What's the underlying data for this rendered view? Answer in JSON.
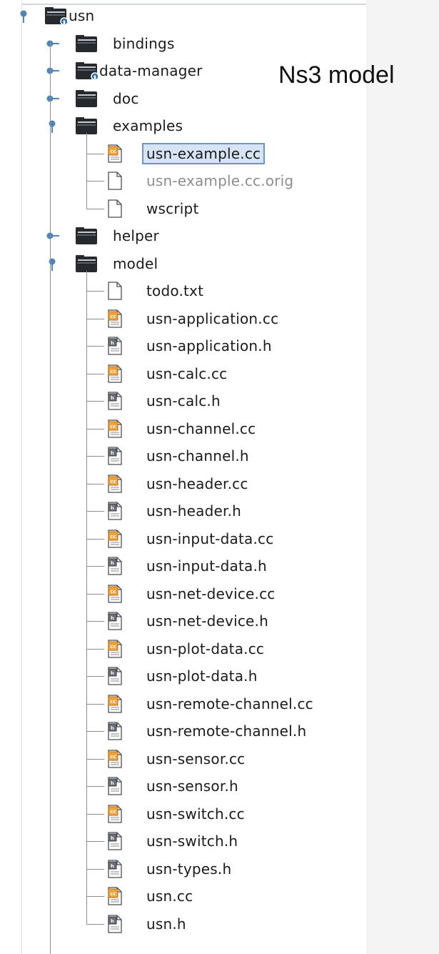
{
  "overlay": {
    "note": "Ns3 model"
  },
  "tree": {
    "root": {
      "label": "usn",
      "badge": "folder-badge-icon"
    },
    "folders": [
      {
        "key": "bindings",
        "label": "bindings",
        "expanded": false
      },
      {
        "key": "data-manager",
        "label": "data-manager",
        "expanded": false,
        "badge": true
      },
      {
        "key": "doc",
        "label": "doc",
        "expanded": false
      },
      {
        "key": "examples",
        "label": "examples",
        "expanded": true,
        "files": [
          {
            "label": "usn-example.cc",
            "type": "cc",
            "selected": true
          },
          {
            "label": "usn-example.cc.orig",
            "type": "plain",
            "dim": true
          },
          {
            "label": "wscript",
            "type": "plain"
          }
        ]
      },
      {
        "key": "helper",
        "label": "helper",
        "expanded": false
      },
      {
        "key": "model",
        "label": "model",
        "expanded": true,
        "files": [
          {
            "label": "todo.txt",
            "type": "plain"
          },
          {
            "label": "usn-application.cc",
            "type": "cc"
          },
          {
            "label": "usn-application.h",
            "type": "h"
          },
          {
            "label": "usn-calc.cc",
            "type": "cc"
          },
          {
            "label": "usn-calc.h",
            "type": "h"
          },
          {
            "label": "usn-channel.cc",
            "type": "cc"
          },
          {
            "label": "usn-channel.h",
            "type": "h"
          },
          {
            "label": "usn-header.cc",
            "type": "cc"
          },
          {
            "label": "usn-header.h",
            "type": "h"
          },
          {
            "label": "usn-input-data.cc",
            "type": "cc"
          },
          {
            "label": "usn-input-data.h",
            "type": "h"
          },
          {
            "label": "usn-net-device.cc",
            "type": "cc"
          },
          {
            "label": "usn-net-device.h",
            "type": "h"
          },
          {
            "label": "usn-plot-data.cc",
            "type": "cc"
          },
          {
            "label": "usn-plot-data.h",
            "type": "h"
          },
          {
            "label": "usn-remote-channel.cc",
            "type": "cc"
          },
          {
            "label": "usn-remote-channel.h",
            "type": "h"
          },
          {
            "label": "usn-sensor.cc",
            "type": "cc"
          },
          {
            "label": "usn-sensor.h",
            "type": "h"
          },
          {
            "label": "usn-switch.cc",
            "type": "cc"
          },
          {
            "label": "usn-switch.h",
            "type": "h"
          },
          {
            "label": "usn-types.h",
            "type": "h"
          },
          {
            "label": "usn.cc",
            "type": "cc"
          },
          {
            "label": "usn.h",
            "type": "h"
          }
        ]
      }
    ]
  },
  "colors": {
    "folder_dark": "#26292d",
    "folder_light": "#c7ccd3",
    "cc_orange": "#f0a33b",
    "tree_line": "#8a8f95",
    "handle_blue": "#4f84b8",
    "selection_fill": "#d7e4f5",
    "selection_border": "#6f93c9"
  }
}
